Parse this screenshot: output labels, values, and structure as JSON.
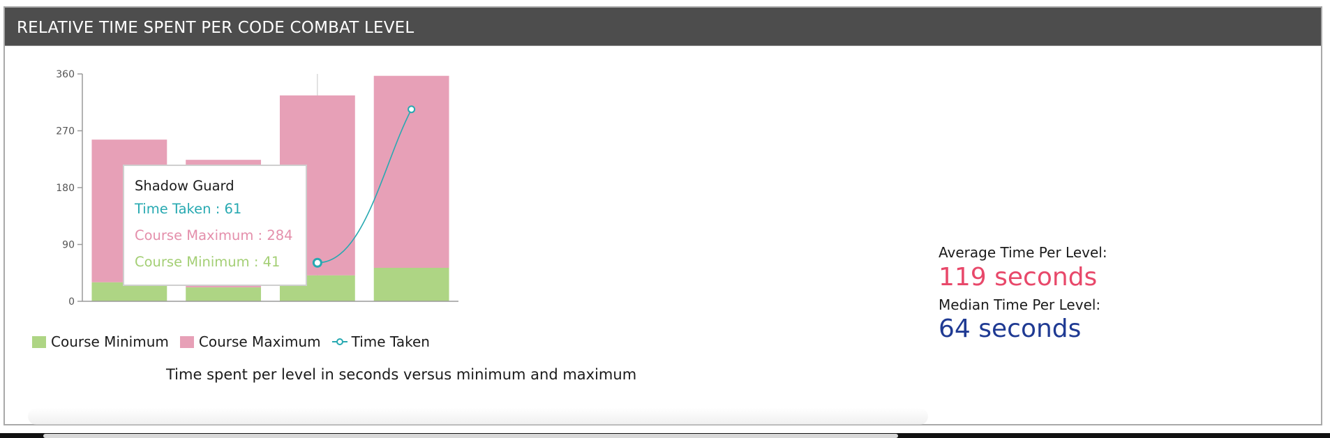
{
  "panel": {
    "title": "RELATIVE TIME SPENT PER CODE COMBAT LEVEL"
  },
  "chart_data": {
    "type": "bar",
    "y_ticks": [
      0,
      90,
      180,
      270,
      360
    ],
    "ylim": [
      0,
      360
    ],
    "categories": [
      "",
      "",
      "Shadow Guard",
      ""
    ],
    "series": [
      {
        "name": "Course Minimum",
        "kind": "bar-stack-base",
        "color": "#aed584",
        "values": [
          30,
          22,
          41,
          53
        ]
      },
      {
        "name": "Course Maximum",
        "kind": "bar-stack-top",
        "color": "#e7a0b7",
        "values": [
          256,
          224,
          326,
          357
        ]
      },
      {
        "name": "Time Taken",
        "kind": "line",
        "color": "#27a9b1",
        "points": [
          [
            2,
            61
          ],
          [
            3,
            304
          ]
        ]
      }
    ],
    "hover_index": 2,
    "tooltip": {
      "title": "Shadow Guard",
      "time_taken": "Time Taken : 61",
      "course_maximum": "Course Maximum : 284",
      "course_minimum": "Course Minimum : 41"
    },
    "legend": [
      {
        "label": "Course Minimum",
        "color": "#aed584",
        "shape": "square"
      },
      {
        "label": "Course Maximum",
        "color": "#e7a0b7",
        "shape": "square"
      },
      {
        "label": "Time Taken",
        "color": "#27a9b1",
        "shape": "line-marker"
      }
    ],
    "caption": "Time spent per level in seconds versus minimum and maximum",
    "grid": false
  },
  "stats": {
    "average_label": "Average Time Per Level:",
    "average_value": "119 seconds",
    "median_label": "Median Time Per Level:",
    "median_value": "64 seconds"
  }
}
